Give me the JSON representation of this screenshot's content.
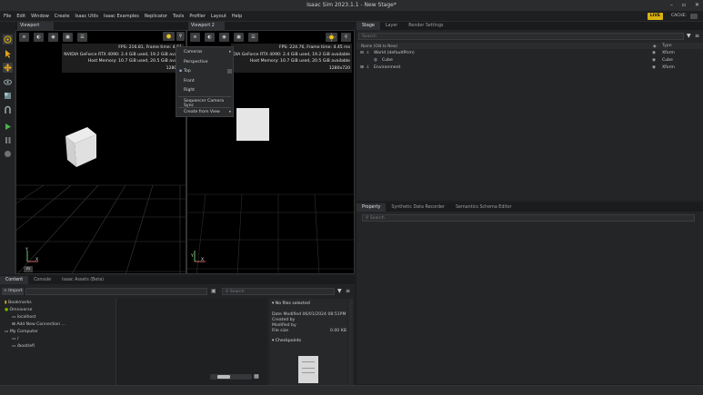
{
  "window": {
    "title": "Isaac Sim 2023.1.1 - New Stage*",
    "controls": [
      "–",
      "▫",
      "✕"
    ]
  },
  "menu": [
    "File",
    "Edit",
    "Window",
    "Create",
    "Isaac Utils",
    "Isaac Examples",
    "Replicator",
    "Tools",
    "Profiler",
    "Layout",
    "Help"
  ],
  "header_right": {
    "live": "LIVE",
    "cache": "CACHE:"
  },
  "viewport1": {
    "tab": "Viewport",
    "fps": "FPS: 216.81, Frame time: 4.61",
    "gpu": "NVIDIA GeForce RTX 4090: 2.4 GiB used, 19.2 GiB availa",
    "host": "Host Memory: 10.7 GiB used, 20.5 GiB availa",
    "res": "1280x7",
    "axis": "Y",
    "axis_x": "X",
    "unit": "m"
  },
  "viewport2": {
    "tab": "Viewport 2",
    "fps": "FPS: 224.76, Frame time: 4.45 ms",
    "gpu": "DIA GeForce RTX 4090: 2.4 GiB used, 19.2 GiB available",
    "host": "Host Memory: 10.7 GiB used, 20.5 GiB available",
    "res": "1280x720",
    "axis": "Y",
    "axis_x": "X"
  },
  "context_menu": [
    "Cameras",
    "Perspective",
    "Top",
    "Front",
    "Right",
    "Sequencer Camera Sync",
    "Create from View"
  ],
  "stage": {
    "tabs": [
      "Stage",
      "Layer",
      "Render Settings"
    ],
    "search": "Search",
    "col_name": "Name (Old to New)",
    "col_type": "Type",
    "rows": [
      {
        "name": "World (defaultPrim)",
        "type": "Xform"
      },
      {
        "name": "Cube",
        "type": "Cube"
      },
      {
        "name": "Environment",
        "type": "Xform"
      }
    ]
  },
  "property": {
    "tabs": [
      "Property",
      "Synthetic Data Recorder",
      "Semantics Schema Editor"
    ],
    "search": "Search"
  },
  "content": {
    "tabs": [
      "Content",
      "Console",
      "Isaac Assets (Beta)"
    ],
    "import": "+ Import",
    "search": "Search",
    "tree": [
      "Bookmarks",
      "Omniverse",
      "localhost",
      "Add New Connection ...",
      "My Computer",
      "/",
      "/boot/efi"
    ],
    "details": {
      "title": "No files selected",
      "date": "Date Modified 06/01/2024 08:51PM",
      "created": "Created by",
      "modified": "Modified by",
      "filesize_label": "File size",
      "filesize": "0.00 KB",
      "checkpoints": "Checkpoints"
    }
  },
  "colors": {
    "accent": "#d8b312",
    "panel": "#2e2f32",
    "bg": "#1d1e20"
  }
}
